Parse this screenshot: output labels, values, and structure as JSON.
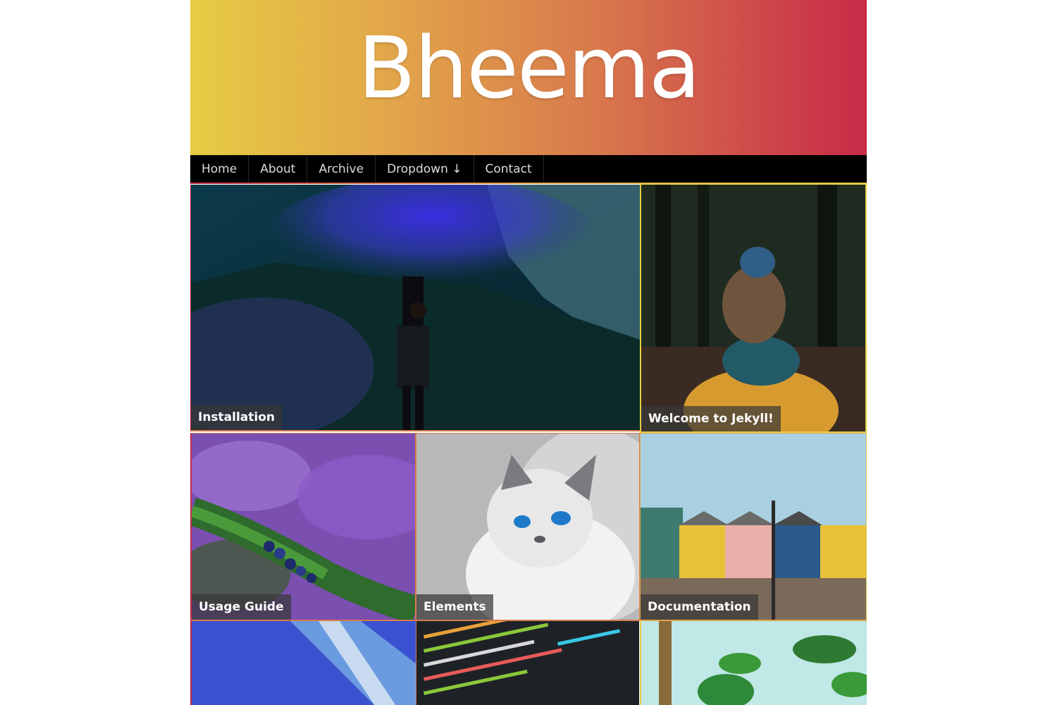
{
  "site": {
    "title": "Bheema"
  },
  "nav": {
    "items": [
      {
        "label": "Home"
      },
      {
        "label": "About"
      },
      {
        "label": "Archive"
      },
      {
        "label": "Dropdown ↓"
      },
      {
        "label": "Contact"
      }
    ]
  },
  "posts": [
    {
      "title": "Installation",
      "image": "person-with-blue-smoke-flare-photo"
    },
    {
      "title": "Welcome to Jekyll!",
      "image": "blue-haired-woman-in-forest-photo"
    },
    {
      "title": "Usage Guide",
      "image": "juniper-berries-and-lavender-photo"
    },
    {
      "title": "Elements",
      "image": "white-cat-with-blue-eyes-photo"
    },
    {
      "title": "Documentation",
      "image": "colorful-row-houses-photo"
    },
    {
      "title": "",
      "image": "blue-fabric-photo"
    },
    {
      "title": "",
      "image": "code-on-screen-photo"
    },
    {
      "title": "",
      "image": "palm-tree-and-plant-photo"
    }
  ],
  "colors": {
    "header_gradient_start": "#e6cc44",
    "header_gradient_end": "#c82a48",
    "nav_background": "#000000",
    "nav_text": "#dcdcdc"
  }
}
